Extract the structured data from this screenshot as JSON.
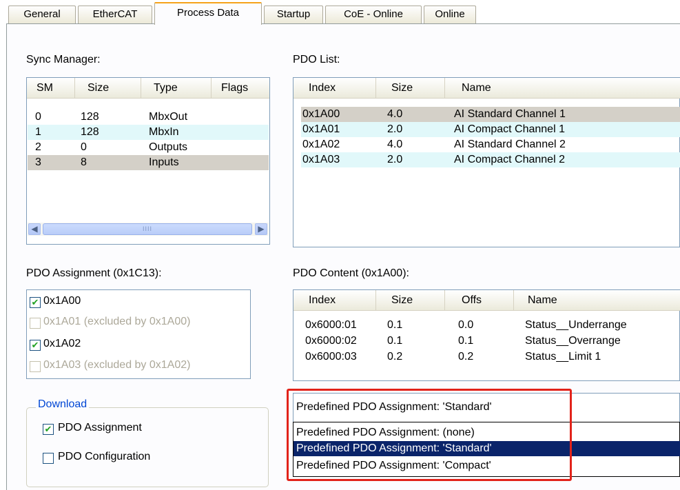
{
  "tabs": [
    {
      "label": "General"
    },
    {
      "label": "EtherCAT"
    },
    {
      "label": "Process Data"
    },
    {
      "label": "Startup"
    },
    {
      "label": "CoE - Online"
    },
    {
      "label": "Online"
    }
  ],
  "sync_manager": {
    "label": "Sync Manager:",
    "columns": [
      "SM",
      "Size",
      "Type",
      "Flags"
    ],
    "rows": [
      {
        "sm": "0",
        "size": "128",
        "type": "MbxOut",
        "flags": ""
      },
      {
        "sm": "1",
        "size": "128",
        "type": "MbxIn",
        "flags": ""
      },
      {
        "sm": "2",
        "size": "0",
        "type": "Outputs",
        "flags": ""
      },
      {
        "sm": "3",
        "size": "8",
        "type": "Inputs",
        "flags": ""
      }
    ],
    "scroll_grip": "IIII"
  },
  "pdo_list": {
    "label": "PDO List:",
    "columns": [
      "Index",
      "Size",
      "Name"
    ],
    "rows": [
      {
        "index": "0x1A00",
        "size": "4.0",
        "name": "AI Standard Channel 1"
      },
      {
        "index": "0x1A01",
        "size": "2.0",
        "name": "AI Compact Channel 1"
      },
      {
        "index": "0x1A02",
        "size": "4.0",
        "name": "AI Standard Channel 2"
      },
      {
        "index": "0x1A03",
        "size": "2.0",
        "name": "AI Compact Channel 2"
      }
    ]
  },
  "pdo_assignment": {
    "label": "PDO Assignment (0x1C13):",
    "items": [
      {
        "label": "0x1A00",
        "checked": true,
        "enabled": true
      },
      {
        "label": "0x1A01 (excluded by 0x1A00)",
        "checked": false,
        "enabled": false
      },
      {
        "label": "0x1A02",
        "checked": true,
        "enabled": true
      },
      {
        "label": "0x1A03 (excluded by 0x1A02)",
        "checked": false,
        "enabled": false
      }
    ]
  },
  "pdo_content": {
    "label": "PDO Content (0x1A00):",
    "columns": [
      "Index",
      "Size",
      "Offs",
      "Name"
    ],
    "rows": [
      {
        "index": "0x6000:01",
        "size": "0.1",
        "offs": "0.0",
        "name": "Status__Underrange"
      },
      {
        "index": "0x6000:02",
        "size": "0.1",
        "offs": "0.1",
        "name": "Status__Overrange"
      },
      {
        "index": "0x6000:03",
        "size": "0.2",
        "offs": "0.2",
        "name": "Status__Limit 1"
      }
    ]
  },
  "download": {
    "legend": "Download",
    "pdo_assignment_label": "PDO Assignment",
    "pdo_assignment_checked": true,
    "pdo_configuration_label": "PDO Configuration",
    "pdo_configuration_checked": false
  },
  "predefined": {
    "selected": "Predefined PDO Assignment: 'Standard'",
    "options": [
      "Predefined PDO Assignment: (none)",
      "Predefined PDO Assignment: 'Standard'",
      "Predefined PDO Assignment: 'Compact'"
    ],
    "highlighted_index": 1
  },
  "colors": {
    "highlight": "#0a246a",
    "alt_row": "#e1f8fa",
    "annotation_red": "#e2231a",
    "active_tab_accent": "#f5a21a"
  }
}
